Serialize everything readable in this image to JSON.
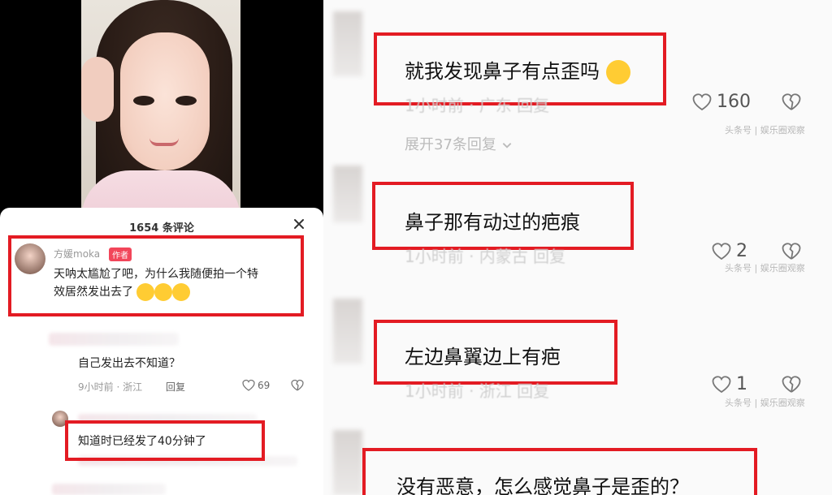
{
  "sheet": {
    "title": "1654 条评论"
  },
  "comments": [
    {
      "user": "方媛moka",
      "badge": "作者",
      "text_line1": "天呐太尴尬了吧，为什么我随便拍一个特",
      "text_line2": "效居然发出去了"
    },
    {
      "text": "自己发出去不知道？",
      "meta": "9小时前 · 浙江",
      "reply": "回复",
      "likes": "69"
    },
    {
      "text": "知道时已经发了40分钟了"
    }
  ],
  "right_comments": [
    {
      "text": "就我发现鼻子有点歪吗",
      "meta": "1小时前 · 广东  回复",
      "likes": "160",
      "watermark": "头条号 | 娱乐圈观察",
      "expand": "展开37条回复"
    },
    {
      "text": "鼻子那有动过的疤痕",
      "meta": "1小时前 · 内蒙古  回复",
      "likes": "2",
      "watermark": "头条号 | 娱乐圈观察"
    },
    {
      "text": "左边鼻翼边上有疤",
      "meta": "1小时前 · 浙江  回复",
      "likes": "1",
      "watermark": "头条号 | 娱乐圈观察"
    },
    {
      "text": "没有恶意，怎么感觉鼻子是歪的？"
    }
  ],
  "icons": {
    "close": "close-icon",
    "like": "heart-icon",
    "dislike": "broken-heart-icon",
    "chevron": "chevron-down-icon"
  },
  "colors": {
    "highlight": "#e31b23",
    "badge": "#f2465a"
  }
}
